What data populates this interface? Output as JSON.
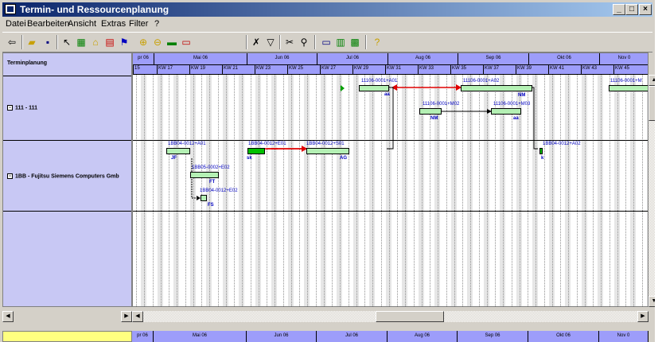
{
  "window": {
    "title": "Termin- und Ressourcenplanung",
    "min": "_",
    "max": "□",
    "close": "×"
  },
  "menu": [
    "Datei",
    "Bearbeiten",
    "Ansicht",
    "Extras",
    "Filter",
    "?"
  ],
  "toolbar_icons": [
    "exit-icon",
    "open-folder-icon",
    "save-icon",
    "pointer-icon",
    "select-icon",
    "link-icon",
    "new-bar-icon",
    "resource-icon",
    "zoom-in-icon",
    "zoom-out-icon",
    "chart-icon",
    "delete-icon",
    "filter-icon",
    "funnel-icon",
    "tools-icon",
    "filter-edit-icon",
    "view-a-icon",
    "view-b-icon",
    "view-c-icon",
    "help-icon"
  ],
  "left": {
    "header": "Terminplanung",
    "rows": [
      {
        "label": "111 - 111",
        "expander": "-"
      },
      {
        "label": "1BB - Fujitsu Siemens Computers Gmb",
        "expander": "-"
      }
    ]
  },
  "timeline": {
    "months": [
      "pr 06",
      "Mai 06",
      "Jun 06",
      "Jul 06",
      "Aug 06",
      "Sep 06",
      "Okt 06",
      "Nov 0"
    ],
    "weeks": [
      "15",
      "KW 17",
      "KW 19",
      "KW 21",
      "KW 23",
      "KW 25",
      "KW 27",
      "KW 29",
      "KW 31",
      "KW 33",
      "KW 35",
      "KW 37",
      "KW 39",
      "KW 41",
      "KW 43",
      "KW 45"
    ]
  },
  "bars": [
    {
      "label": "11106-0001+A01",
      "res": "aa"
    },
    {
      "label": "11106-0001+A02",
      "res": "NM"
    },
    {
      "label": "11106-0001+M02",
      "res": "NM"
    },
    {
      "label": "11106-0001+M03",
      "res": "aa"
    },
    {
      "label": "11106-0001+M",
      "res": ""
    },
    {
      "label": "1BB04-0012+A01",
      "res": "JF"
    },
    {
      "label": "1BB04-0012+E01",
      "res": "sk"
    },
    {
      "label": "1BB04-0012+S01",
      "res": "AG"
    },
    {
      "label": "1BB05-0002+E02",
      "res": "FT"
    },
    {
      "label": "1BB04-0012+E02",
      "res": "FS"
    },
    {
      "label": "1BB04-0012+A02",
      "res": "k"
    }
  ],
  "colors": {
    "title_start": "#0a246a",
    "title_end": "#a6caf0",
    "timeline": "#9d9dfa",
    "left_panel": "#c8c8f4",
    "bar": "#b4f0b4",
    "bar_active": "#00c000",
    "dependency_critical": "#e00000",
    "dependency": "#000000",
    "bottom_left": "#ffff80"
  }
}
